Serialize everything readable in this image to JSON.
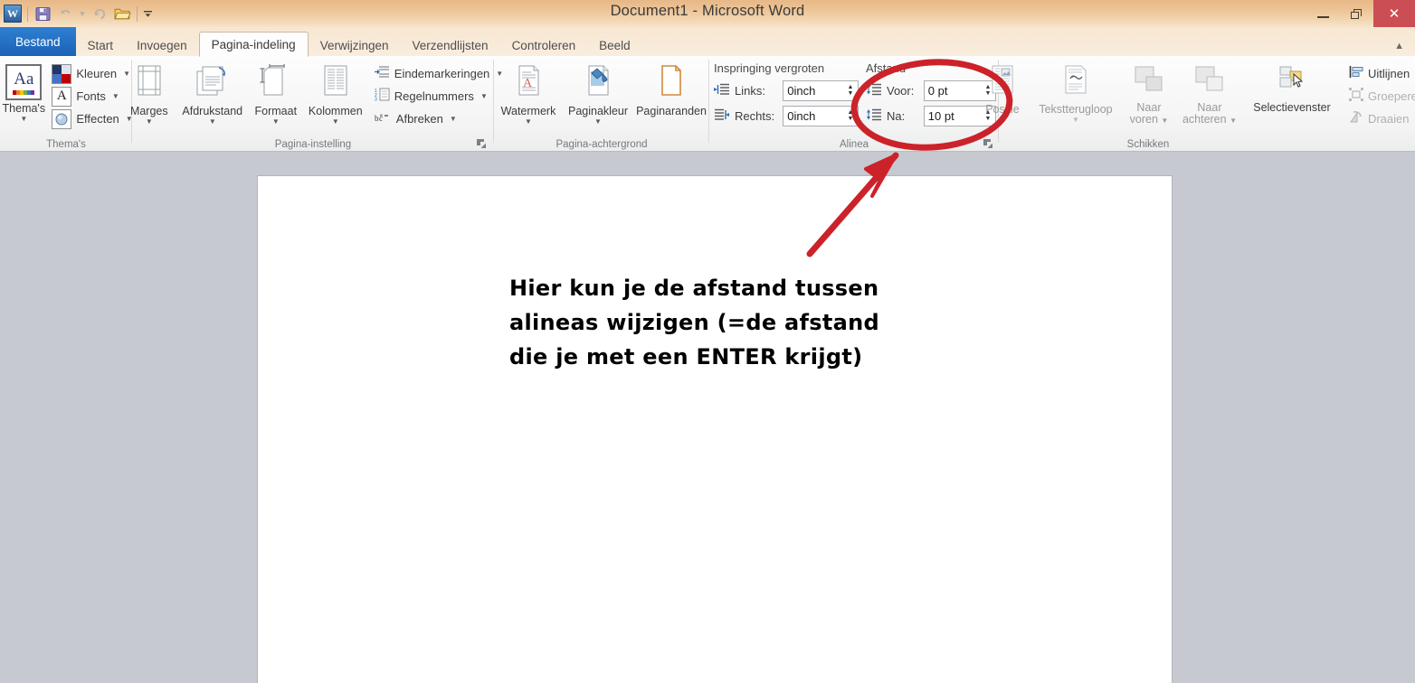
{
  "window": {
    "title": "Document1  -  Microsoft Word",
    "minimize_label": "Minimaliseren",
    "restore_label": "Vorig formaat",
    "close_label": "Sluiten"
  },
  "quick_access": {
    "logo_label": "W",
    "items": [
      {
        "name": "save-icon",
        "label": "Opslaan"
      },
      {
        "name": "undo-icon",
        "label": "Ongedaan maken"
      },
      {
        "name": "undo-dropdown-icon",
        "label": "Ongedaan maken opties"
      },
      {
        "name": "redo-icon",
        "label": "Opnieuw"
      },
      {
        "name": "open-icon",
        "label": "Openen"
      },
      {
        "name": "customize-qat-icon",
        "label": "Werkbalk Snelle toegang aanpassen"
      }
    ]
  },
  "tabs": [
    {
      "label": "Bestand",
      "type": "file"
    },
    {
      "label": "Start",
      "type": "normal"
    },
    {
      "label": "Invoegen",
      "type": "normal"
    },
    {
      "label": "Pagina-indeling",
      "type": "active"
    },
    {
      "label": "Verwijzingen",
      "type": "normal"
    },
    {
      "label": "Verzendlijsten",
      "type": "normal"
    },
    {
      "label": "Controleren",
      "type": "normal"
    },
    {
      "label": "Beeld",
      "type": "normal"
    }
  ],
  "ribbon": {
    "collapse_label": "Lint minimaliseren",
    "groups": {
      "themes": {
        "label": "Thema's",
        "big_button": "Thema's",
        "small_buttons": [
          "Kleuren",
          "Fonts",
          "Effecten"
        ]
      },
      "page_setup": {
        "label": "Pagina-instelling",
        "big_buttons": [
          "Marges",
          "Afdrukstand",
          "Formaat",
          "Kolommen"
        ],
        "small_buttons": [
          "Eindemarkeringen",
          "Regelnummers",
          "Afbreken"
        ],
        "launcher_label": "Dialoogvenster Pagina-instelling"
      },
      "page_background": {
        "label": "Pagina-achtergrond",
        "big_buttons": [
          "Watermerk",
          "Paginakleur",
          "Paginaranden"
        ]
      },
      "paragraph": {
        "label": "Alinea",
        "indent_header": "Inspringing vergroten",
        "spacing_header": "Afstand",
        "fields": [
          {
            "label": "Links:",
            "value": "0inch"
          },
          {
            "label": "Rechts:",
            "value": "0inch"
          },
          {
            "label": "Voor:",
            "value": "0 pt"
          },
          {
            "label": "Na:",
            "value": "10 pt"
          }
        ],
        "launcher_label": "Dialoogvenster Alinea"
      },
      "arrange": {
        "label": "Schikken",
        "big_buttons": [
          "Positie",
          "Tekstterugloop",
          "Naar voren",
          "Naar achteren",
          "Selectievenster"
        ],
        "small_buttons": [
          "Uitlijnen",
          "Groeperen",
          "Draaien"
        ]
      }
    }
  },
  "document": {
    "lines": [
      "Hier kun je de afstand tussen",
      "alineas wijzigen (=de afstand",
      "die je met een ENTER krijgt)"
    ]
  },
  "annotation": {
    "color": "#cc2229",
    "ellipse_label": "Markering rond Afstand-velden",
    "arrow_label": "Pijl naar Afstand-velden"
  },
  "colors": {
    "accent": "#cc2229",
    "title_bar": "#edc598",
    "file_tab": "#1a62b5",
    "doc_background": "#c6cad0"
  }
}
